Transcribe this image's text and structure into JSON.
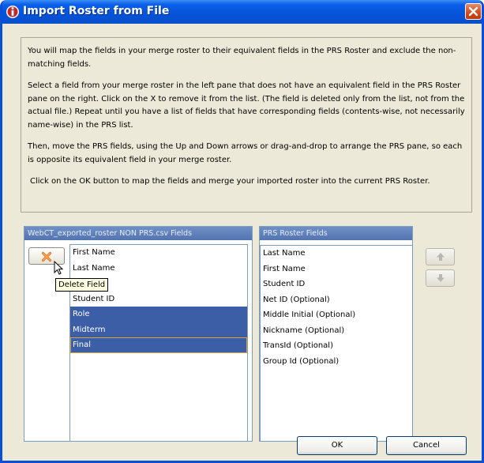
{
  "window": {
    "title": "Import Roster from File"
  },
  "instructions": {
    "p1": "You will map the fields in your merge roster to their equivalent fields in the PRS Roster and exclude the non-matching fields.",
    "p2": "Select a field from your merge roster in the left pane that does not have an equivalent field in the PRS Roster pane on the right. Click on the X to remove it from the list. (The field is deleted only from the list, not from the actual file.) Repeat until you have a list of fields that have corresponding fields (contents-wise, not necessarily name-wise) in the PRS list.",
    "p3": "Then, move the PRS fields, using the Up and Down arrows or drag-and-drop to arrange the PRS pane, so each is opposite its equivalent field in your merge roster.",
    "p4": "Click on the OK button to map the fields and merge your imported roster into the current PRS Roster."
  },
  "left_pane": {
    "header": "WebCT_exported_roster NON PRS.csv Fields",
    "items": [
      {
        "label": "First Name",
        "selected": false
      },
      {
        "label": "Last Name",
        "selected": false
      },
      {
        "label": "",
        "selected": false
      },
      {
        "label": "Student ID",
        "selected": false
      },
      {
        "label": "Role",
        "selected": true
      },
      {
        "label": "Midterm",
        "selected": true
      },
      {
        "label": "Final",
        "selected": true
      }
    ],
    "delete_tooltip": "Delete Field"
  },
  "right_pane": {
    "header": "PRS Roster Fields",
    "items": [
      {
        "label": "Last Name"
      },
      {
        "label": "First Name"
      },
      {
        "label": "Student ID"
      },
      {
        "label": "Net ID (Optional)"
      },
      {
        "label": "Middle Initial (Optional)"
      },
      {
        "label": "Nickname (Optional)"
      },
      {
        "label": "TransId (Optional)"
      },
      {
        "label": "Group Id (Optional)"
      }
    ]
  },
  "buttons": {
    "ok": "OK",
    "cancel": "Cancel"
  },
  "icons": {
    "app": "app-logo-icon",
    "close": "close-icon",
    "delete": "delete-x-icon",
    "up": "arrow-up-icon",
    "down": "arrow-down-icon",
    "cursor": "mouse-pointer-icon"
  },
  "colors": {
    "titlebar": "#0553d8",
    "selection": "#3b5ea6",
    "pane_header": "#5474b0",
    "dialog_bg": "#ece9d8",
    "delete_x": "#e8761e"
  }
}
